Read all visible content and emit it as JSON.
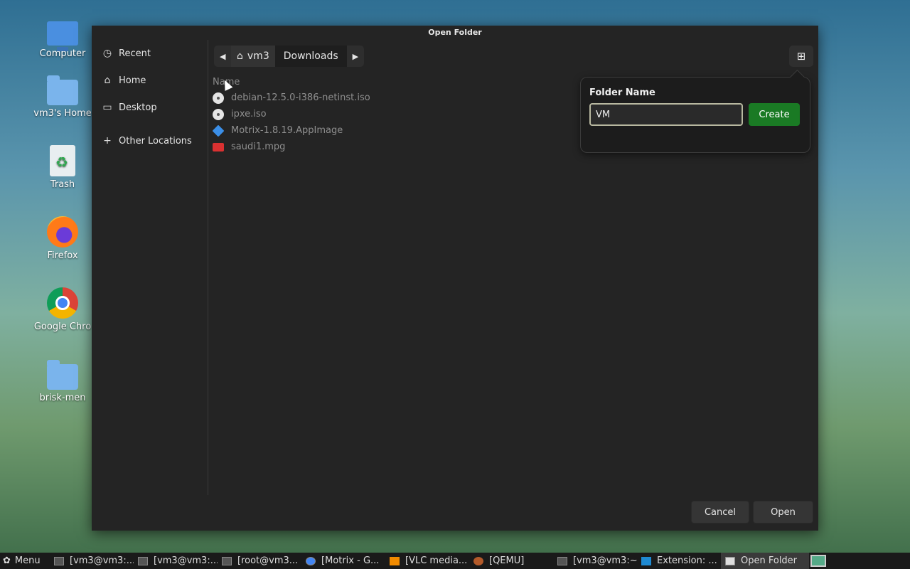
{
  "desktop": {
    "icons": [
      {
        "label": "Computer",
        "icon": "computer-icon"
      },
      {
        "label": "vm3's Home",
        "icon": "home-folder-icon"
      },
      {
        "label": "Trash",
        "icon": "trash-icon"
      },
      {
        "label": "Firefox",
        "icon": "firefox-icon"
      },
      {
        "label": "Google Chro",
        "icon": "chrome-icon"
      },
      {
        "label": "brisk-men",
        "icon": "folder-icon"
      }
    ]
  },
  "dialog": {
    "title": "Open Folder",
    "sidebar": [
      {
        "label": "Recent",
        "icon": "clock-icon"
      },
      {
        "label": "Home",
        "icon": "home-icon"
      },
      {
        "label": "Desktop",
        "icon": "folder-icon"
      },
      {
        "label": "Other Locations",
        "icon": "plus-icon"
      }
    ],
    "pathbar": {
      "home": "vm3",
      "current": "Downloads"
    },
    "column_header": "Name",
    "files": [
      {
        "name": "debian-12.5.0-i386-netinst.iso",
        "icon": "disc-icon"
      },
      {
        "name": "ipxe.iso",
        "icon": "disc-icon"
      },
      {
        "name": "Motrix-1.8.19.AppImage",
        "icon": "appimage-icon"
      },
      {
        "name": "saudi1.mpg",
        "icon": "video-icon"
      }
    ],
    "new_folder_popover": {
      "title": "Folder Name",
      "value": "VM",
      "create_label": "Create"
    },
    "cancel_label": "Cancel",
    "open_label": "Open"
  },
  "taskbar": {
    "menu_label": "Menu",
    "tasks": [
      "[vm3@vm3:...",
      "[vm3@vm3:...",
      "[root@vm3...",
      "[Motrix - G...",
      "[VLC media...",
      "[QEMU]",
      "[vm3@vm3:~]",
      "Extension: ...",
      "Open Folder"
    ]
  }
}
